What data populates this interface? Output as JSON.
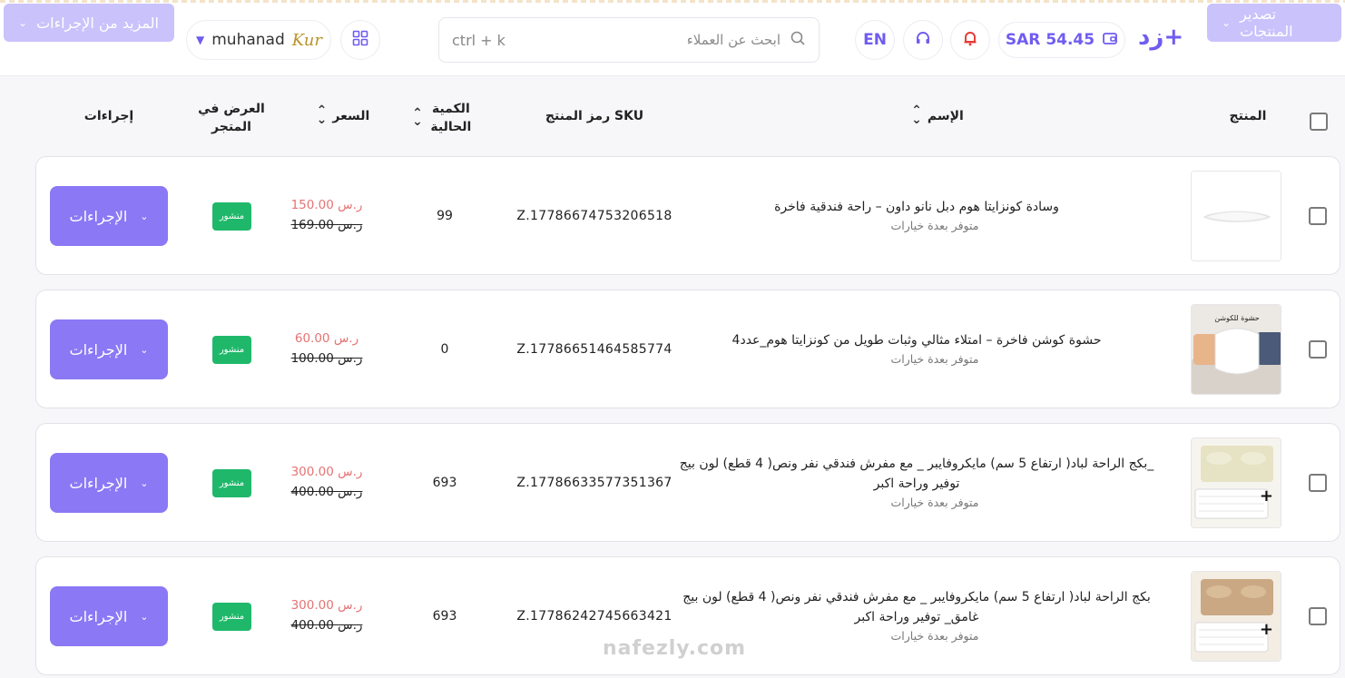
{
  "topbar": {
    "export_label": "تصدير المنتجات",
    "more_actions_label": "المزيد من الإجراءات",
    "brand_logo": "زد+",
    "wallet_amount": "SAR  54.45",
    "lang_label": "EN",
    "search": {
      "placeholder": "ابحث عن العملاء",
      "shortcut": "ctrl + k"
    },
    "user": {
      "name": "muhanad",
      "logo_text": "Kur"
    }
  },
  "table": {
    "headers": {
      "product": "المنتج",
      "name": "الإسم",
      "sku": "رمز المنتج SKU",
      "quantity": "الكمية الحالية",
      "price": "السعر",
      "display": "العرض في المتجر",
      "actions": "إجراءات"
    },
    "rows": [
      {
        "name": "وسادة كونزايتا هوم دبل نانو داون – راحة فندقية فاخرة",
        "name_line2": "",
        "variants": "متوفر بعدة خيارات",
        "sku": "Z.17786674753206518",
        "qty": "99",
        "sale_price": "150.00 ر.س",
        "old_price": "169.00 ر.س",
        "status": "منشور",
        "actions_label": "الإجراءات",
        "thumb_plus": ""
      },
      {
        "name": "حشوة كوشن فاخرة – امتلاء مثالي وثبات طويل من كونزايتا هوم_عدد4",
        "name_line2": "",
        "variants": "متوفر بعدة خيارات",
        "sku": "Z.17786651464585774",
        "qty": "0",
        "sale_price": "60.00 ر.س",
        "old_price": "100.00 ر.س",
        "status": "منشور",
        "actions_label": "الإجراءات",
        "thumb_plus": "",
        "thumb_text": "حشوة للكوشن"
      },
      {
        "name": "بكج الراحة لباد( ارتفاع 5 سم) مايكروفايبر _ مع مفرش فندقي نفر ونص( 4 قطع) لون بيج_",
        "name_line2": "توفير وراحة اكبر",
        "variants": "متوفر بعدة خيارات",
        "sku": "Z.17786633577351367",
        "qty": "693",
        "sale_price": "300.00 ر.س",
        "old_price": "400.00 ر.س",
        "status": "منشور",
        "actions_label": "الإجراءات",
        "thumb_plus": "+"
      },
      {
        "name": "بكج الراحة لباد( ارتفاع 5 سم) مايكروفايبر _ مع مفرش فندقي نفر ونص( 4 قطع) لون بيج",
        "name_line2": "غامق_ توفير وراحة اكبر",
        "variants": "متوفر بعدة خيارات",
        "sku": "Z.17786242745663421",
        "qty": "693",
        "sale_price": "300.00 ر.س",
        "old_price": "400.00 ر.س",
        "status": "منشور",
        "actions_label": "الإجراءات",
        "thumb_plus": "+"
      }
    ]
  },
  "watermark": "nafezly.com",
  "colors": {
    "primary": "#8b78f5",
    "primary_faded": "#c9c2fb",
    "published_badge": "#1fb86b",
    "sale_price": "#e57373",
    "bell": "#e53935"
  }
}
